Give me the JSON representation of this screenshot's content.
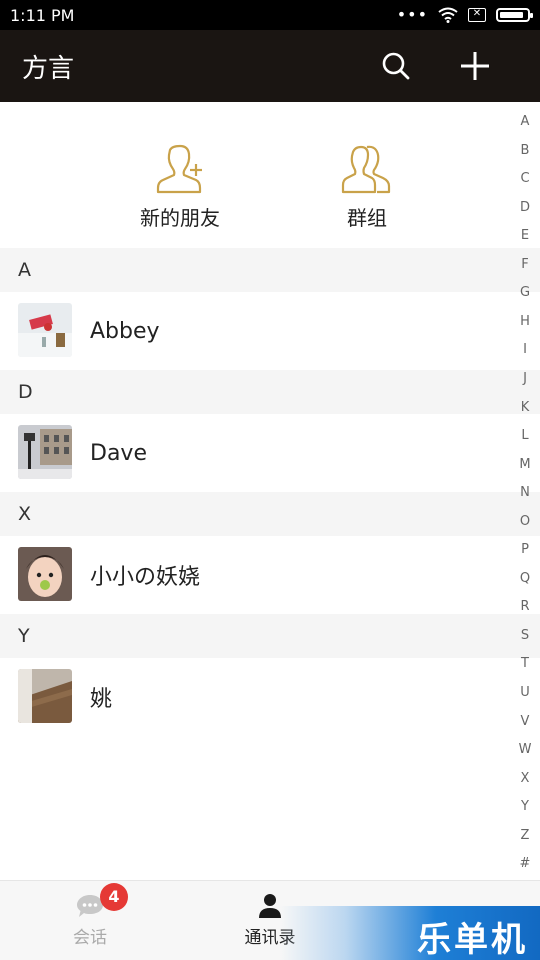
{
  "status_bar": {
    "time": "1:11 PM",
    "battery_level": 0.9
  },
  "header": {
    "title": "方言"
  },
  "shortcuts": [
    {
      "label": "新的朋友",
      "icon": "add-friend-icon"
    },
    {
      "label": "群组",
      "icon": "group-icon"
    }
  ],
  "sections": [
    {
      "letter": "A",
      "contacts": [
        {
          "name": "Abbey"
        }
      ]
    },
    {
      "letter": "D",
      "contacts": [
        {
          "name": "Dave"
        }
      ]
    },
    {
      "letter": "X",
      "contacts": [
        {
          "name": "小小の妖娆"
        }
      ]
    },
    {
      "letter": "Y",
      "contacts": [
        {
          "name": "姚"
        }
      ]
    }
  ],
  "index_letters": [
    "A",
    "B",
    "C",
    "D",
    "E",
    "F",
    "G",
    "H",
    "I",
    "J",
    "K",
    "L",
    "M",
    "N",
    "O",
    "P",
    "Q",
    "R",
    "S",
    "T",
    "U",
    "V",
    "W",
    "X",
    "Y",
    "Z",
    "#"
  ],
  "bottom_nav": {
    "items": [
      {
        "label": "会话",
        "badge": "4",
        "icon": "chat-bubble-icon",
        "active": false
      },
      {
        "label": "通讯录",
        "icon": "person-icon",
        "active": true
      }
    ]
  },
  "watermark": {
    "text": "乐单机"
  },
  "colors": {
    "header_bg": "#1a1512",
    "accent_gold": "#c9a24a",
    "badge_red": "#e53935",
    "section_bg": "#f5f5f5"
  }
}
